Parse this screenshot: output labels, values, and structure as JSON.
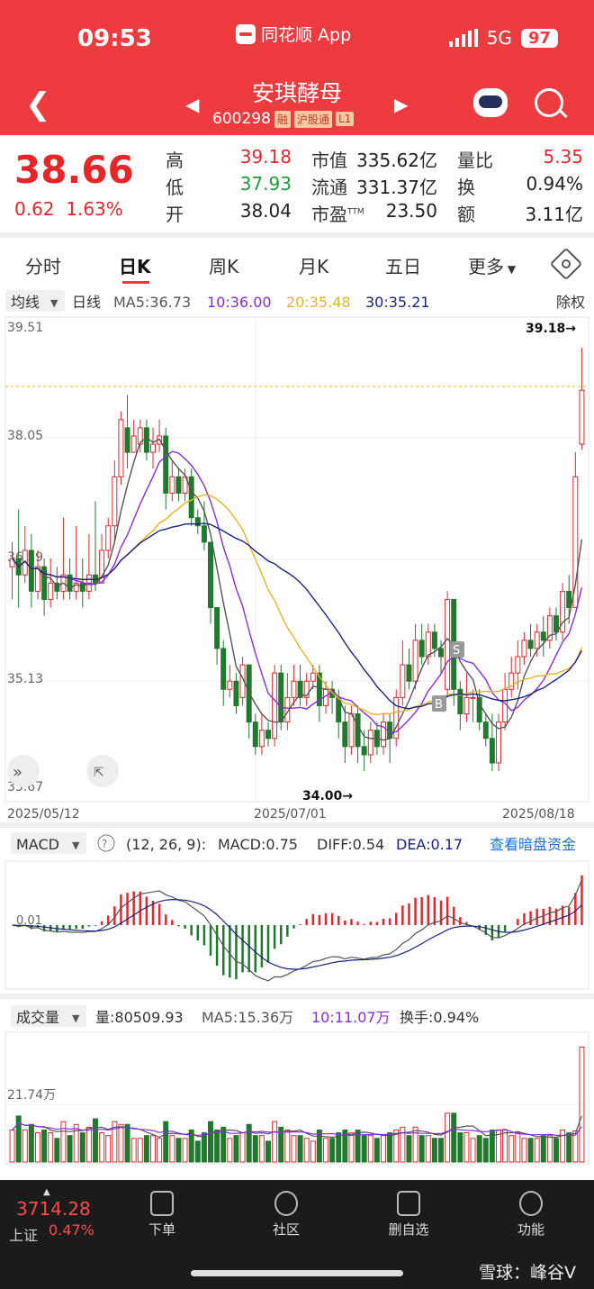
{
  "status_bar": {
    "time": "09:53",
    "network": "5G",
    "battery": "97",
    "app": "同花顺 App"
  },
  "header": {
    "stock_name": "安琪酵母",
    "code": "600298",
    "tags": [
      "融",
      "沪股通",
      "L1"
    ]
  },
  "quote": {
    "price": "38.66",
    "change": "0.62",
    "change_pct": "1.63%",
    "high_label": "高",
    "high": "39.18",
    "low_label": "低",
    "low": "37.93",
    "open_label": "开",
    "open": "38.04",
    "mcap_label": "市值",
    "mcap": "335.62亿",
    "float_label": "流通",
    "float": "331.37亿",
    "pe_label": "市盈",
    "pe_sup": "TTM",
    "pe": "23.50",
    "volratio_label": "量比",
    "volratio": "5.35",
    "turnover_label": "换",
    "turnover": "0.94%",
    "amount_label": "额",
    "amount": "3.11亿"
  },
  "tabs": [
    "分时",
    "日K",
    "周K",
    "月K",
    "五日",
    "更多"
  ],
  "active_tab": "日K",
  "kline": {
    "type_label": "均线",
    "period_label": "日线",
    "ma5": "MA5:36.73",
    "ma10": "10:36.00",
    "ma20": "20:35.48",
    "ma30": "30:35.21",
    "adjust": "除权",
    "y_ticks": [
      "39.51",
      "38.05",
      "36.59",
      "35.13",
      "33.67"
    ],
    "x_ticks": [
      "2025/05/12",
      "2025/07/01",
      "2025/08/18"
    ],
    "max_label": "39.18→",
    "min_label": "34.00→",
    "marker_b": "B",
    "marker_s": "S"
  },
  "macd": {
    "label": "MACD",
    "params": "(12, 26, 9):",
    "macd": "MACD:0.75",
    "diff": "DIFF:0.54",
    "dea": "DEA:0.17",
    "link": "查看暗盘资金",
    "zero_label": "0.01"
  },
  "volume": {
    "label": "成交量",
    "vol": "量:80509.93",
    "ma5": "MA5:15.36万",
    "ma10": "10:11.07万",
    "turnover": "换手:0.94%",
    "tick": "21.74万"
  },
  "bottom": {
    "index_value": "3714.28",
    "index_name": "上证",
    "index_pct": "0.47%",
    "nav": [
      "下单",
      "社区",
      "删自选",
      "功能"
    ],
    "watermark": "雪球：峰谷V"
  },
  "colors": {
    "up": "#e8262a",
    "down": "#1f7a2e",
    "ma5": "#555555",
    "ma10": "#8a2be2",
    "ma20": "#e6b422",
    "ma30": "#1a237e",
    "header": "#ed3b3f"
  },
  "chart_data": {
    "type": "candlestick",
    "ylim": [
      33.67,
      39.51
    ],
    "candles": [
      [
        36.5,
        36.6,
        36.1,
        36.8
      ],
      [
        36.6,
        36.4,
        36.0,
        37.2
      ],
      [
        36.4,
        36.7,
        36.3,
        37.0
      ],
      [
        36.7,
        36.2,
        36.0,
        36.9
      ],
      [
        36.2,
        36.5,
        36.1,
        36.7
      ],
      [
        36.5,
        36.1,
        35.9,
        36.6
      ],
      [
        36.1,
        36.3,
        36.0,
        36.6
      ],
      [
        36.3,
        36.2,
        36.1,
        36.5
      ],
      [
        36.2,
        36.4,
        36.1,
        37.1
      ],
      [
        36.4,
        36.2,
        36.1,
        36.6
      ],
      [
        36.2,
        36.3,
        36.1,
        37.0
      ],
      [
        36.3,
        36.2,
        36.0,
        36.6
      ],
      [
        36.2,
        36.4,
        36.1,
        36.9
      ],
      [
        36.4,
        36.3,
        36.2,
        37.3
      ],
      [
        36.3,
        36.7,
        36.3,
        36.9
      ],
      [
        36.7,
        37.0,
        36.6,
        37.1
      ],
      [
        37.0,
        37.6,
        36.8,
        37.8
      ],
      [
        37.6,
        38.3,
        37.5,
        38.4
      ],
      [
        38.2,
        37.9,
        37.7,
        38.6
      ],
      [
        37.9,
        38.1,
        37.9,
        38.3
      ],
      [
        38.0,
        38.2,
        37.9,
        38.3
      ],
      [
        38.2,
        37.9,
        37.8,
        38.3
      ],
      [
        37.9,
        38.0,
        37.7,
        38.2
      ],
      [
        38.0,
        38.1,
        37.9,
        38.3
      ],
      [
        38.1,
        37.4,
        37.2,
        38.2
      ],
      [
        37.4,
        37.6,
        37.3,
        37.8
      ],
      [
        37.6,
        37.4,
        37.3,
        37.7
      ],
      [
        37.4,
        37.6,
        37.3,
        37.7
      ],
      [
        37.6,
        37.1,
        37.0,
        37.7
      ],
      [
        37.1,
        37.0,
        36.9,
        37.2
      ],
      [
        37.0,
        36.8,
        36.7,
        37.3
      ],
      [
        36.8,
        36.0,
        35.8,
        36.8
      ],
      [
        36.0,
        35.5,
        35.3,
        36.0
      ],
      [
        35.5,
        35.0,
        34.8,
        35.6
      ],
      [
        35.0,
        35.1,
        34.9,
        35.3
      ],
      [
        35.1,
        34.8,
        34.7,
        35.2
      ],
      [
        34.9,
        35.3,
        34.8,
        35.4
      ],
      [
        35.3,
        34.6,
        34.4,
        35.3
      ],
      [
        34.6,
        34.3,
        34.2,
        34.7
      ],
      [
        34.3,
        34.5,
        34.2,
        34.7
      ],
      [
        34.5,
        34.4,
        34.3,
        34.6
      ],
      [
        34.4,
        35.2,
        34.3,
        35.3
      ],
      [
        35.2,
        34.6,
        34.5,
        35.3
      ],
      [
        34.6,
        34.9,
        34.5,
        35.2
      ],
      [
        34.9,
        35.1,
        34.8,
        35.3
      ],
      [
        35.1,
        34.9,
        34.8,
        35.3
      ],
      [
        34.9,
        35.1,
        34.8,
        35.2
      ],
      [
        35.1,
        35.2,
        35.0,
        35.3
      ],
      [
        35.2,
        34.8,
        34.6,
        35.3
      ],
      [
        34.8,
        35.0,
        34.7,
        35.1
      ],
      [
        35.0,
        34.9,
        34.7,
        35.1
      ],
      [
        34.9,
        34.6,
        34.4,
        35.0
      ],
      [
        34.6,
        34.3,
        34.1,
        34.8
      ],
      [
        34.3,
        34.7,
        34.2,
        34.8
      ],
      [
        34.7,
        34.3,
        34.1,
        34.8
      ],
      [
        34.3,
        34.2,
        34.0,
        34.5
      ],
      [
        34.2,
        34.5,
        34.1,
        34.6
      ],
      [
        34.5,
        34.3,
        34.2,
        34.6
      ],
      [
        34.3,
        34.6,
        34.2,
        34.7
      ],
      [
        34.6,
        34.4,
        34.1,
        34.7
      ],
      [
        34.4,
        34.9,
        34.3,
        35.0
      ],
      [
        34.9,
        35.3,
        34.8,
        35.6
      ],
      [
        35.3,
        35.1,
        35.0,
        35.5
      ],
      [
        35.1,
        35.6,
        35.0,
        35.8
      ],
      [
        35.6,
        35.4,
        35.3,
        35.8
      ],
      [
        35.4,
        35.7,
        35.3,
        35.8
      ],
      [
        35.7,
        35.5,
        35.4,
        35.8
      ],
      [
        35.5,
        35.4,
        35.2,
        35.6
      ],
      [
        35.0,
        36.1,
        34.9,
        36.2
      ],
      [
        36.1,
        35.0,
        34.8,
        36.1
      ],
      [
        35.0,
        34.7,
        34.5,
        35.1
      ],
      [
        34.7,
        34.9,
        34.6,
        35.2
      ],
      [
        34.9,
        34.9,
        34.6,
        35.0
      ],
      [
        34.9,
        34.6,
        34.5,
        35.0
      ],
      [
        34.6,
        34.4,
        34.3,
        34.7
      ],
      [
        34.4,
        34.1,
        34.0,
        34.7
      ],
      [
        34.1,
        34.6,
        34.0,
        34.7
      ],
      [
        34.6,
        35.0,
        34.5,
        35.2
      ],
      [
        35.0,
        35.2,
        34.9,
        35.4
      ],
      [
        35.2,
        35.4,
        35.0,
        35.6
      ],
      [
        35.4,
        35.6,
        35.3,
        35.7
      ],
      [
        35.6,
        35.5,
        35.4,
        35.8
      ],
      [
        35.5,
        35.7,
        35.4,
        35.8
      ],
      [
        35.7,
        35.6,
        35.4,
        35.9
      ],
      [
        35.6,
        35.9,
        35.5,
        36.0
      ],
      [
        35.9,
        35.7,
        35.6,
        36.0
      ],
      [
        35.7,
        36.2,
        35.6,
        36.3
      ],
      [
        36.2,
        36.0,
        35.8,
        36.4
      ],
      [
        36.0,
        37.6,
        36.0,
        37.9
      ],
      [
        38.0,
        38.66,
        37.93,
        39.18
      ]
    ],
    "volume_ylim": [
      0,
      40
    ],
    "volume_tick": 21.74
  }
}
